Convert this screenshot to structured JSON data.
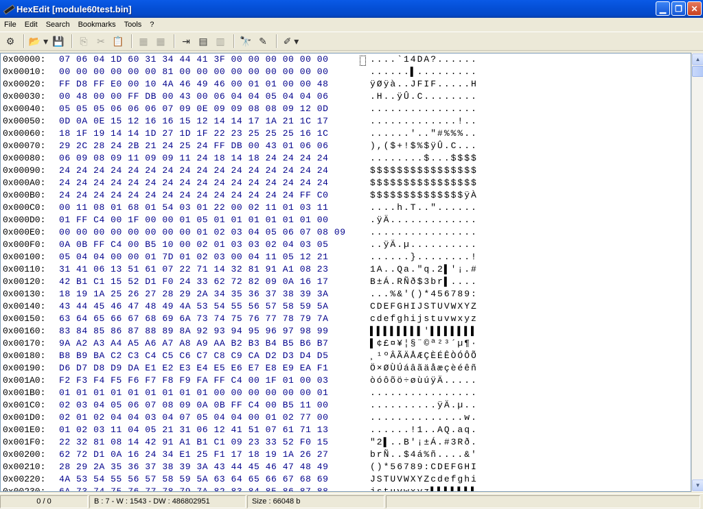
{
  "window": {
    "title": "HexEdit [module60test.bin]"
  },
  "menu": [
    "File",
    "Edit",
    "Search",
    "Bookmarks",
    "Tools",
    "?"
  ],
  "toolbar": [
    {
      "icon": "properties-icon",
      "enabled": true,
      "glyph": "⚙"
    },
    {
      "icon": "open-folder-icon",
      "enabled": true,
      "glyph": "📂",
      "dropdown": true
    },
    {
      "icon": "save-icon",
      "enabled": false,
      "glyph": "💾"
    },
    {
      "icon": "copy-icon",
      "enabled": false,
      "glyph": "⎘"
    },
    {
      "icon": "cut-icon",
      "enabled": false,
      "glyph": "✂"
    },
    {
      "icon": "paste-icon",
      "enabled": false,
      "glyph": "📋"
    },
    {
      "icon": "hex-copy-icon",
      "enabled": false,
      "glyph": "▦"
    },
    {
      "icon": "hex-paste-icon",
      "enabled": false,
      "glyph": "▦"
    },
    {
      "icon": "goto-icon",
      "enabled": true,
      "glyph": "⇥"
    },
    {
      "icon": "calculator-icon",
      "enabled": true,
      "glyph": "▤"
    },
    {
      "icon": "bookmark-list-icon",
      "enabled": false,
      "glyph": "▥"
    },
    {
      "icon": "find-icon",
      "enabled": true,
      "glyph": "🔭"
    },
    {
      "icon": "replace-icon",
      "enabled": true,
      "glyph": "✎"
    },
    {
      "icon": "highlight-icon",
      "enabled": true,
      "glyph": "✐",
      "dropdown": true
    }
  ],
  "rows": [
    {
      "addr": "0x00000:",
      "hex": "07 06 04 1D 60 31 34 44 41 3F 00 00 00 00 00 00",
      "ascii": "....`14DA?......"
    },
    {
      "addr": "0x00010:",
      "hex": "00 00 00 00 00 00 81 00 00 00 00 00 00 00 00 00",
      "ascii": "......▌........."
    },
    {
      "addr": "0x00020:",
      "hex": "FF D8 FF E0 00 10 4A 46 49 46 00 01 01 00 00 48",
      "ascii": "ÿØÿà..JFIF.....H"
    },
    {
      "addr": "0x00030:",
      "hex": "00 48 00 00 FF DB 00 43 00 06 04 04 05 04 04 06",
      "ascii": ".H..ÿÛ.C........"
    },
    {
      "addr": "0x00040:",
      "hex": "05 05 05 06 06 06 07 09 0E 09 09 08 08 09 12 0D",
      "ascii": "................"
    },
    {
      "addr": "0x00050:",
      "hex": "0D 0A 0E 15 12 16 16 15 12 14 14 17 1A 21 1C 17",
      "ascii": ".............!.."
    },
    {
      "addr": "0x00060:",
      "hex": "18 1F 19 14 14 1D 27 1D 1F 22 23 25 25 25 16 1C",
      "ascii": "......'..\"#%%%.."
    },
    {
      "addr": "0x00070:",
      "hex": "29 2C 28 24 2B 21 24 25 24 FF DB 00 43 01 06 06",
      "ascii": "),($+!$%$ÿÛ.C..."
    },
    {
      "addr": "0x00080:",
      "hex": "06 09 08 09 11 09 09 11 24 18 14 18 24 24 24 24",
      "ascii": "........$...$$$$"
    },
    {
      "addr": "0x00090:",
      "hex": "24 24 24 24 24 24 24 24 24 24 24 24 24 24 24 24",
      "ascii": "$$$$$$$$$$$$$$$$"
    },
    {
      "addr": "0x000A0:",
      "hex": "24 24 24 24 24 24 24 24 24 24 24 24 24 24 24 24",
      "ascii": "$$$$$$$$$$$$$$$$"
    },
    {
      "addr": "0x000B0:",
      "hex": "24 24 24 24 24 24 24 24 24 24 24 24 24 24 FF C0",
      "ascii": "$$$$$$$$$$$$$$ÿÀ"
    },
    {
      "addr": "0x000C0:",
      "hex": "00 11 08 01 68 01 54 03 01 22 00 02 11 01 03 11",
      "ascii": "....h.T..\"......"
    },
    {
      "addr": "0x000D0:",
      "hex": "01 FF C4 00 1F 00 00 01 05 01 01 01 01 01 01 00",
      "ascii": ".ÿÄ............."
    },
    {
      "addr": "0x000E0:",
      "hex": "00 00 00 00 00 00 00 00 01 02 03 04 05 06 07 08 09",
      "ascii": "................"
    },
    {
      "addr": "0x000F0:",
      "hex": "0A 0B FF C4 00 B5 10 00 02 01 03 03 02 04 03 05",
      "ascii": "..ÿÄ.µ.........."
    },
    {
      "addr": "0x00100:",
      "hex": "05 04 04 00 00 01 7D 01 02 03 00 04 11 05 12 21",
      "ascii": "......}........!"
    },
    {
      "addr": "0x00110:",
      "hex": "31 41 06 13 51 61 07 22 71 14 32 81 91 A1 08 23",
      "ascii": "1A..Qa.\"q.2▌'¡.#"
    },
    {
      "addr": "0x00120:",
      "hex": "42 B1 C1 15 52 D1 F0 24 33 62 72 82 09 0A 16 17",
      "ascii": "B±Á.RÑð$3br▌...."
    },
    {
      "addr": "0x00130:",
      "hex": "18 19 1A 25 26 27 28 29 2A 34 35 36 37 38 39 3A",
      "ascii": "...%&'()*456789:"
    },
    {
      "addr": "0x00140:",
      "hex": "43 44 45 46 47 48 49 4A 53 54 55 56 57 58 59 5A",
      "ascii": "CDEFGHIJSTUVWXYZ"
    },
    {
      "addr": "0x00150:",
      "hex": "63 64 65 66 67 68 69 6A 73 74 75 76 77 78 79 7A",
      "ascii": "cdefghijstuvwxyz"
    },
    {
      "addr": "0x00160:",
      "hex": "83 84 85 86 87 88 89 8A 92 93 94 95 96 97 98 99",
      "ascii": "▌▌▌▌▌▌▌▌'▌▌▌▌▌▌▌"
    },
    {
      "addr": "0x00170:",
      "hex": "9A A2 A3 A4 A5 A6 A7 A8 A9 AA B2 B3 B4 B5 B6 B7",
      "ascii": "▌¢£¤¥¦§¨©ª²³´µ¶·"
    },
    {
      "addr": "0x00180:",
      "hex": "B8 B9 BA C2 C3 C4 C5 C6 C7 C8 C9 CA D2 D3 D4 D5",
      "ascii": "¸¹ºÂÃÄÅÆÇÈÉÊÒÓÔÕ"
    },
    {
      "addr": "0x00190:",
      "hex": "D6 D7 D8 D9 DA E1 E2 E3 E4 E5 E6 E7 E8 E9 EA F1",
      "ascii": "Ö×ØÙÚáâãäåæçèéêñ"
    },
    {
      "addr": "0x001A0:",
      "hex": "F2 F3 F4 F5 F6 F7 F8 F9 FA FF C4 00 1F 01 00 03",
      "ascii": "òóôõö÷øùúÿÄ....."
    },
    {
      "addr": "0x001B0:",
      "hex": "01 01 01 01 01 01 01 01 01 00 00 00 00 00 00 01",
      "ascii": "................"
    },
    {
      "addr": "0x001C0:",
      "hex": "02 03 04 05 06 07 08 09 0A 0B FF C4 00 B5 11 00",
      "ascii": "..........ÿÄ.µ.."
    },
    {
      "addr": "0x001D0:",
      "hex": "02 01 02 04 04 03 04 07 05 04 04 00 01 02 77 00",
      "ascii": "..............w."
    },
    {
      "addr": "0x001E0:",
      "hex": "01 02 03 11 04 05 21 31 06 12 41 51 07 61 71 13",
      "ascii": "......!1..AQ.aq."
    },
    {
      "addr": "0x001F0:",
      "hex": "22 32 81 08 14 42 91 A1 B1 C1 09 23 33 52 F0 15",
      "ascii": "\"2▌..B'¡±Á.#3Rð."
    },
    {
      "addr": "0x00200:",
      "hex": "62 72 D1 0A 16 24 34 E1 25 F1 17 18 19 1A 26 27",
      "ascii": "brÑ..$4á%ñ....&'"
    },
    {
      "addr": "0x00210:",
      "hex": "28 29 2A 35 36 37 38 39 3A 43 44 45 46 47 48 49",
      "ascii": "()*56789:CDEFGHI"
    },
    {
      "addr": "0x00220:",
      "hex": "4A 53 54 55 56 57 58 59 5A 63 64 65 66 67 68 69",
      "ascii": "JSTUVWXYZcdefghi"
    },
    {
      "addr": "0x00230:",
      "hex": "6A 73 74 75 76 77 78 79 7A 82 83 84 85 86 87 88",
      "ascii": "jstuvwxyz▌▌▌▌▌▌▌"
    }
  ],
  "status": {
    "position": "0 / 0",
    "values": "B : 7 - W : 1543 - DW : 486802951",
    "size": "Size : 66048 b"
  }
}
